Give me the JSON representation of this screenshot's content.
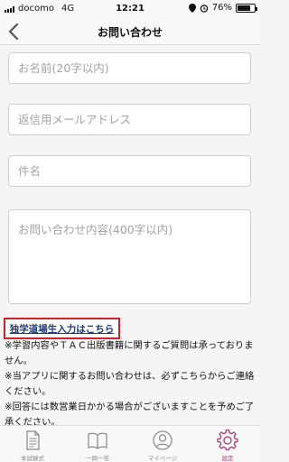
{
  "status_bar": {
    "carrier": "docomo",
    "network": "4G",
    "time": "12:21",
    "battery_percent": "76%",
    "battery_level": 0.76
  },
  "nav": {
    "title": "お問い合わせ",
    "back_icon": "chevron-left-icon"
  },
  "form": {
    "name_placeholder": "お名前(20字以内)",
    "email_placeholder": "返信用メールアドレス",
    "subject_placeholder": "件名",
    "body_placeholder": "お問い合わせ内容(400字以内)"
  },
  "special_link": "独学道場生入力はこちら",
  "notes": [
    "※学習内容やＴＡＣ出版書籍に関するご質問は承っておりません。",
    "※当アプリに関するお問い合わせは、必ずこちらからご連絡ください。",
    "※回答には数営業日かかる場合がございますことを予めご了承ください。"
  ],
  "tabs": [
    {
      "label": "本試験式",
      "icon": "document-icon",
      "active": false
    },
    {
      "label": "一問一答",
      "icon": "book-icon",
      "active": false
    },
    {
      "label": "マイページ",
      "icon": "person-icon",
      "active": false
    },
    {
      "label": "設定",
      "icon": "gear-icon",
      "active": true
    }
  ],
  "colors": {
    "accent": "#b03a6b",
    "link": "#1d3a7a",
    "link_border": "#d0202a"
  }
}
